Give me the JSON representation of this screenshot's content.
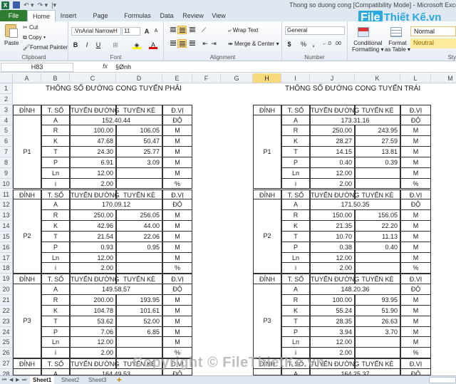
{
  "window": {
    "title": "Thong so duong cong  [Compatibility Mode]  -  Microsoft Excel"
  },
  "ribbon_tabs": [
    "File",
    "Home",
    "Insert",
    "Page Layout",
    "Formulas",
    "Data",
    "Review",
    "View"
  ],
  "ribbon": {
    "clipboard": {
      "paste": "Paste",
      "cut": "Cut",
      "copy": "Copy",
      "format_painter": "Format Painter",
      "label": "Clipboard"
    },
    "font": {
      "name": ".VnArial NarrowH",
      "size": "11",
      "label": "Font"
    },
    "alignment": {
      "wrap_text": "Wrap Text",
      "merge_center": "Merge & Center",
      "label": "Alignment"
    },
    "number": {
      "format": "General",
      "currency": "$",
      "percent": "%",
      "comma": ",",
      "label": "Number"
    },
    "styles": {
      "conditional_formatting_1": "Conditional",
      "conditional_formatting_2": "Formatting",
      "format_table_1": "Format",
      "format_table_2": "as Table",
      "normal": "Normal",
      "neutral": "Neutral",
      "label": "Sty"
    }
  },
  "logo": {
    "part1": "File",
    "part2": "Thiết Kế.vn"
  },
  "formula_bar": {
    "name_box": "H83",
    "fx": "fx",
    "content": "§Ønh"
  },
  "columns": [
    "A",
    "B",
    "C",
    "D",
    "E",
    "F",
    "G",
    "H",
    "I",
    "J",
    "K",
    "L",
    "M"
  ],
  "selected_column": "H",
  "rows": [
    "1",
    "2",
    "3",
    "4",
    "5",
    "6",
    "7",
    "8",
    "9",
    "10",
    "11",
    "12",
    "13",
    "14",
    "15",
    "16",
    "17",
    "18",
    "19",
    "20",
    "21",
    "22",
    "23",
    "24",
    "25",
    "26",
    "27",
    "28"
  ],
  "sheet": {
    "left_title": "THÔNG SỐ ĐƯỜNG CONG TUYẾN PHẢI",
    "right_title": "THÔNG SỐ ĐƯỜNG CONG TUYẾN TRÁI",
    "headers": [
      "ĐỈNH",
      "T. SỐ",
      "TUYẾN ĐƯỜNG",
      "TUYẾN KÈ",
      "Đ.VỊ"
    ],
    "param_labels": [
      "A",
      "R",
      "K",
      "T",
      "P",
      "Ln",
      "i"
    ],
    "units": [
      "ĐỘ",
      "M",
      "M",
      "M",
      "M",
      "M",
      "%"
    ],
    "left": [
      {
        "peak": "P1",
        "angle": "152.40.44",
        "road": [
          "100.00",
          "47.68",
          "24.30",
          "6.91",
          "12.00",
          "2.00"
        ],
        "embankment": [
          "106.05",
          "50.47",
          "25.77",
          "3.09",
          "",
          ""
        ]
      },
      {
        "peak": "P2",
        "angle": "170.09.12",
        "road": [
          "250.00",
          "42.96",
          "21.54",
          "0.93",
          "12.00",
          "2.00"
        ],
        "embankment": [
          "256.05",
          "44.00",
          "22.06",
          "0.95",
          "",
          ""
        ]
      },
      {
        "peak": "P3",
        "angle": "149.58.57",
        "road": [
          "200.00",
          "104.78",
          "53.62",
          "7.06",
          "12.00",
          "2.00"
        ],
        "embankment": [
          "193.95",
          "101.61",
          "52.00",
          "6.85",
          "",
          ""
        ]
      },
      {
        "peak": "",
        "angle": "164.49.53",
        "road": [],
        "embankment": []
      }
    ],
    "right": [
      {
        "peak": "P1",
        "angle": "173.31.16",
        "road": [
          "250.00",
          "28.27",
          "14.15",
          "0.40",
          "12.00",
          "2.00"
        ],
        "embankment": [
          "243.95",
          "27.59",
          "13.81",
          "0.39",
          "",
          ""
        ]
      },
      {
        "peak": "P2",
        "angle": "171.50.35",
        "road": [
          "150.00",
          "21.35",
          "10.70",
          "0.38",
          "12.00",
          "2.00"
        ],
        "embankment": [
          "156.05",
          "22.20",
          "11.13",
          "0.40",
          "",
          ""
        ]
      },
      {
        "peak": "P3",
        "angle": "148.20.36",
        "road": [
          "100.00",
          "55.24",
          "28.35",
          "3.94",
          "12.00",
          "2.00"
        ],
        "embankment": [
          "93.95",
          "51.90",
          "26.63",
          "3.70",
          "",
          ""
        ]
      },
      {
        "peak": "",
        "angle": "164.25.37",
        "road": [],
        "embankment": []
      }
    ]
  },
  "sheet_tabs": [
    "Sheet1",
    "Sheet2",
    "Sheet3"
  ],
  "active_sheet": "Sheet1",
  "watermark": "Copyright © FileThietKe.vn"
}
